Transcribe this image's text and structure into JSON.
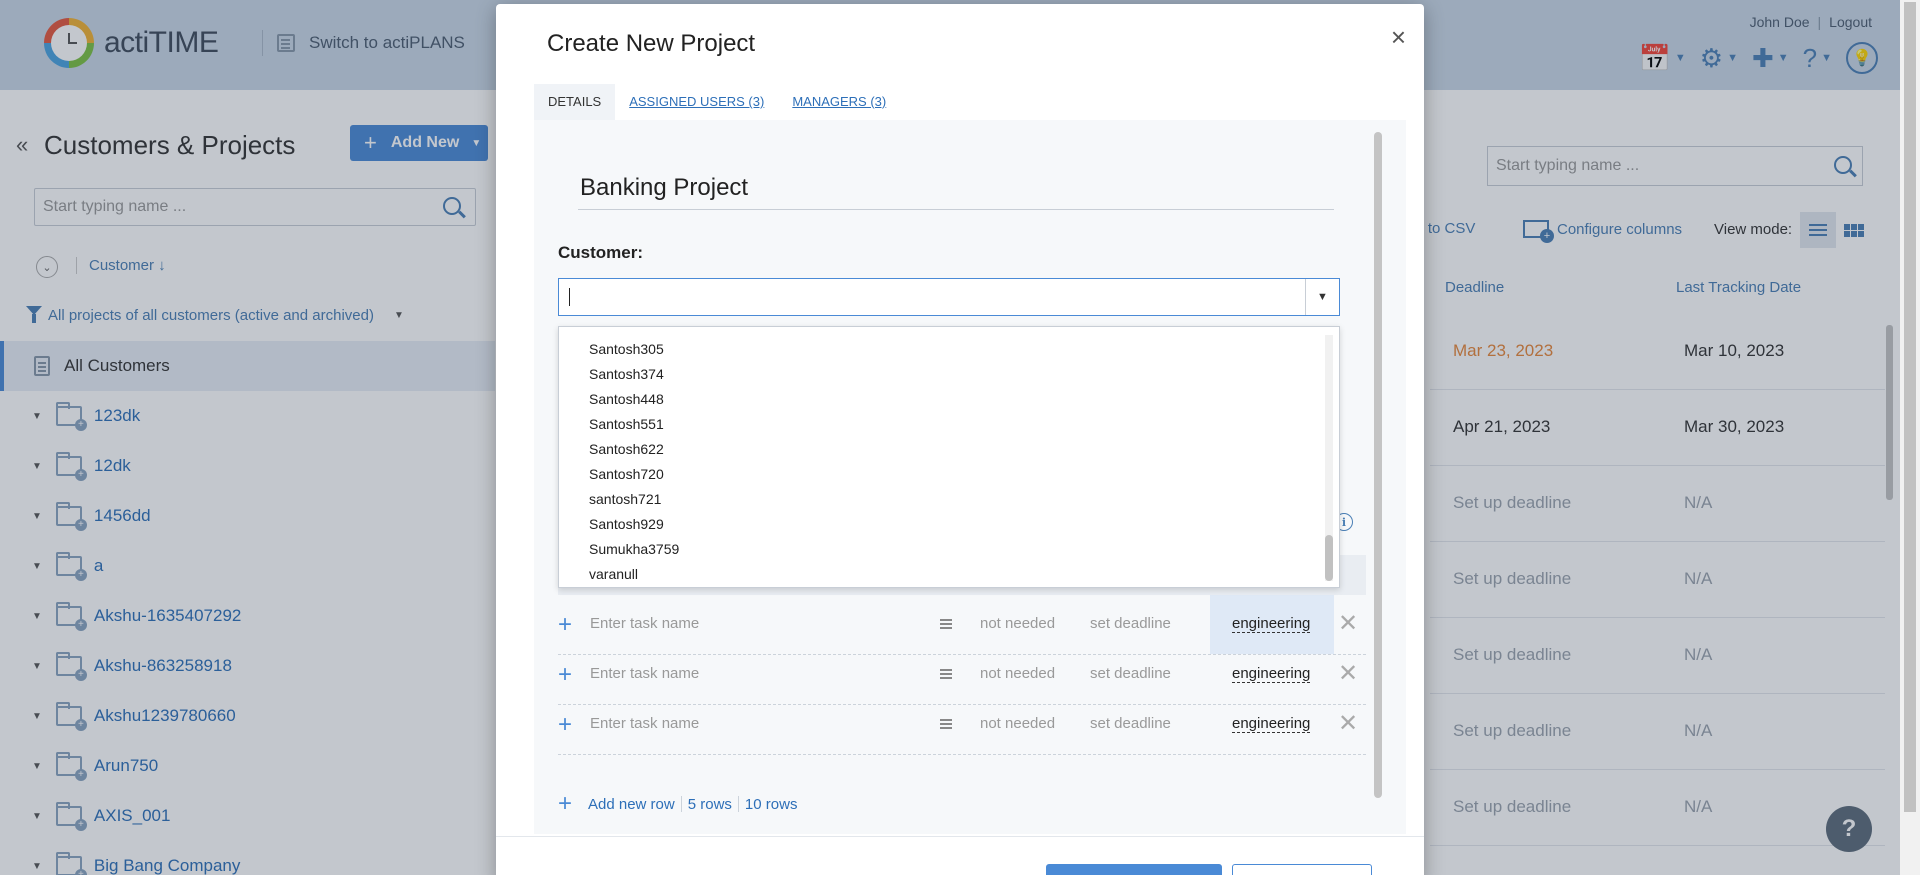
{
  "header": {
    "app_name": "actiTIME",
    "switch_label": "Switch to actiPLANS",
    "user_name": "John Doe",
    "logout_label": "Logout"
  },
  "left_panel": {
    "title": "Customers & Projects",
    "add_new_label": "Add New",
    "search_placeholder": "Start typing name ...",
    "sort_label": "Customer ↓",
    "filter_label": "All projects of all customers (active and archived)",
    "all_customers_label": "All Customers",
    "customers": [
      "123dk",
      "12dk",
      "1456dd",
      "a",
      "Akshu-1635407292",
      "Akshu-863258918",
      "Akshu1239780660",
      "Arun750",
      "AXIS_001",
      "Big Bang Company"
    ]
  },
  "right_panel": {
    "search_placeholder": "Start typing name ...",
    "export_label": "st to CSV",
    "configure_columns_label": "Configure columns",
    "view_mode_label": "View mode:",
    "columns": {
      "deadline": "Deadline",
      "last_tracking": "Last Tracking Date"
    },
    "rows": [
      {
        "deadline": "Mar 23, 2023",
        "tracking": "Mar 10, 2023",
        "status": "overdue"
      },
      {
        "deadline": "Apr 21, 2023",
        "tracking": "Mar 30, 2023",
        "status": "set"
      },
      {
        "deadline": "Set up deadline",
        "tracking": "N/A",
        "status": "none"
      },
      {
        "deadline": "Set up deadline",
        "tracking": "N/A",
        "status": "none"
      },
      {
        "deadline": "Set up deadline",
        "tracking": "N/A",
        "status": "none"
      },
      {
        "deadline": "Set up deadline",
        "tracking": "N/A",
        "status": "none"
      },
      {
        "deadline": "Set up deadline",
        "tracking": "N/A",
        "status": "none"
      }
    ],
    "help_label": "?"
  },
  "modal": {
    "title": "Create New Project",
    "close_label": "×",
    "tabs": [
      {
        "label": "DETAILS",
        "active": true
      },
      {
        "label": "ASSIGNED USERS (3)",
        "active": false
      },
      {
        "label": "MANAGERS (3)",
        "active": false
      }
    ],
    "project_name": "Banking Project",
    "customer_label": "Customer:",
    "customer_value": "",
    "dropdown_options": [
      "Santosh305",
      "Santosh374",
      "Santosh448",
      "Santosh551",
      "Santosh622",
      "Santosh720",
      "santosh721",
      "Santosh929",
      "Sumukha3759",
      "varanull"
    ],
    "task_rows": [
      {
        "placeholder": "Enter task name",
        "estimate": "not needed",
        "deadline": "set deadline",
        "type": "engineering",
        "highlight": true
      },
      {
        "placeholder": "Enter task name",
        "estimate": "not needed",
        "deadline": "set deadline",
        "type": "engineering",
        "highlight": false
      },
      {
        "placeholder": "Enter task name",
        "estimate": "not needed",
        "deadline": "set deadline",
        "type": "engineering",
        "highlight": false
      }
    ],
    "add_new_row_label": "Add new row",
    "five_rows_label": "5 rows",
    "ten_rows_label": "10 rows"
  },
  "colors": {
    "accent": "#4a8ad6",
    "link": "#2d6fb8",
    "overdue": "#e8873a",
    "header_bg": "#c9d7e6"
  }
}
